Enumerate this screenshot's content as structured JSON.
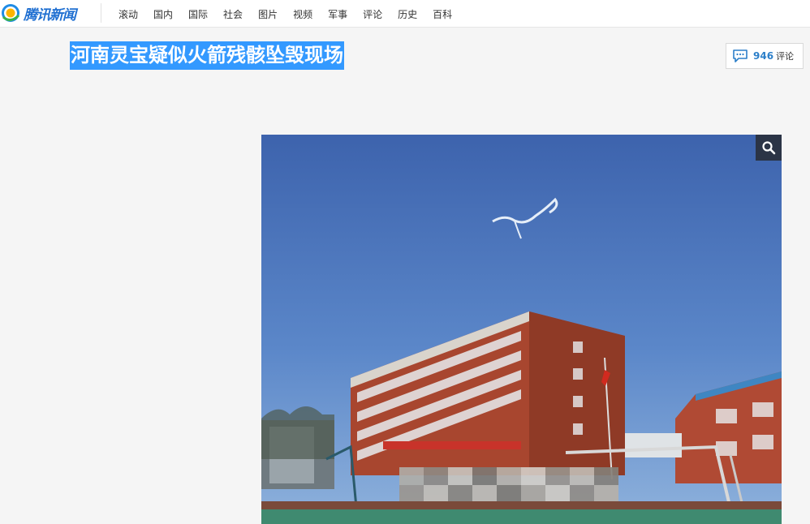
{
  "header": {
    "logo_text": "腾讯新闻",
    "logo_icon": "tencent-news-logo-icon",
    "nav": [
      {
        "label": "滚动"
      },
      {
        "label": "国内"
      },
      {
        "label": "国际"
      },
      {
        "label": "社会"
      },
      {
        "label": "图片"
      },
      {
        "label": "视频"
      },
      {
        "label": "军事"
      },
      {
        "label": "评论"
      },
      {
        "label": "历史"
      },
      {
        "label": "百科"
      }
    ]
  },
  "article": {
    "title": "河南灵宝疑似火箭残骸坠毁现场",
    "comment_count": "946",
    "comment_label": "评论",
    "comment_icon": "comment-bubble-icon",
    "zoom_icon": "search-icon"
  },
  "colors": {
    "accent": "#1f6fd1",
    "selection": "#3399ff",
    "comment_count": "#2c7fc9"
  }
}
